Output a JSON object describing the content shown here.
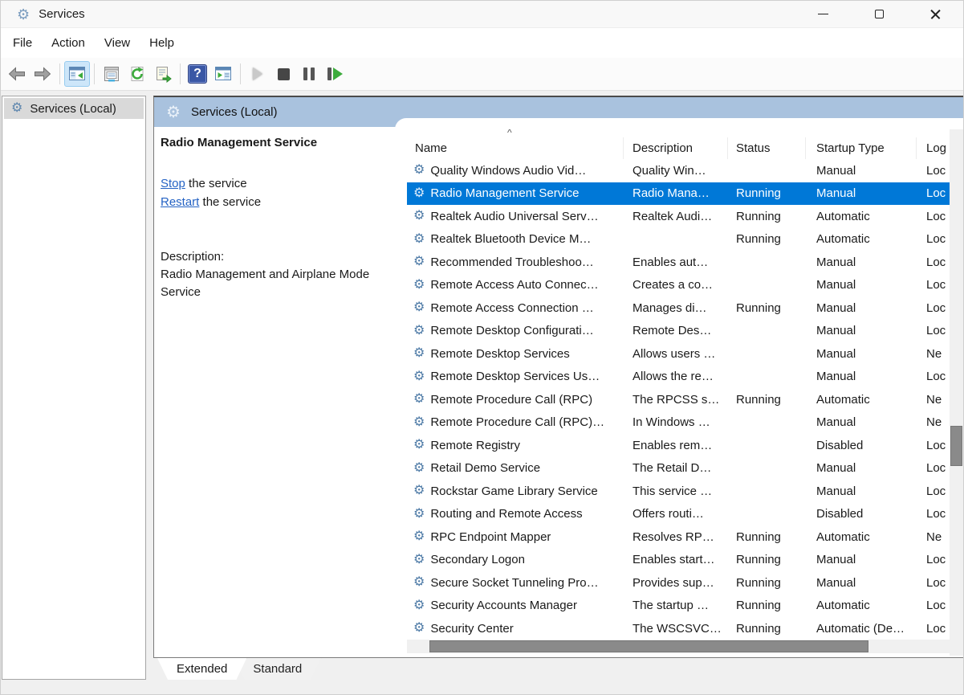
{
  "window": {
    "title": "Services"
  },
  "menu": {
    "items": [
      "File",
      "Action",
      "View",
      "Help"
    ]
  },
  "toolbar": {
    "icons": [
      "back-icon",
      "forward-icon",
      "show-console-tree-icon",
      "properties-icon",
      "refresh-icon",
      "export-list-icon",
      "help-icon",
      "show-action-pane-icon",
      "start-service-icon",
      "stop-service-icon",
      "pause-service-icon",
      "restart-service-icon"
    ],
    "help_glyph": "?"
  },
  "icons": {
    "gear_glyph": "⚙"
  },
  "tree": {
    "root_item": "Services (Local)"
  },
  "banner": {
    "title": "Services (Local)"
  },
  "detail": {
    "service_name": "Radio Management Service",
    "stop_link": "Stop",
    "stop_rest": " the service",
    "restart_link": "Restart",
    "restart_rest": " the service",
    "description_label": "Description:",
    "description_text": "Radio Management and Airplane Mode Service"
  },
  "table": {
    "columns": [
      "Name",
      "Description",
      "Status",
      "Startup Type",
      "Log"
    ],
    "sort_indicator": "^",
    "rows": [
      {
        "name": "Quality Windows Audio Vid…",
        "description": "Quality Win…",
        "status": "",
        "startup": "Manual",
        "logon": "Loc",
        "selected": false
      },
      {
        "name": "Radio Management Service",
        "description": "Radio Mana…",
        "status": "Running",
        "startup": "Manual",
        "logon": "Loc",
        "selected": true
      },
      {
        "name": "Realtek Audio Universal Serv…",
        "description": "Realtek Audi…",
        "status": "Running",
        "startup": "Automatic",
        "logon": "Loc",
        "selected": false
      },
      {
        "name": "Realtek Bluetooth Device M…",
        "description": "",
        "status": "Running",
        "startup": "Automatic",
        "logon": "Loc",
        "selected": false
      },
      {
        "name": "Recommended Troubleshoo…",
        "description": "Enables aut…",
        "status": "",
        "startup": "Manual",
        "logon": "Loc",
        "selected": false
      },
      {
        "name": "Remote Access Auto Connec…",
        "description": "Creates a co…",
        "status": "",
        "startup": "Manual",
        "logon": "Loc",
        "selected": false
      },
      {
        "name": "Remote Access Connection …",
        "description": "Manages di…",
        "status": "Running",
        "startup": "Manual",
        "logon": "Loc",
        "selected": false
      },
      {
        "name": "Remote Desktop Configurati…",
        "description": "Remote Des…",
        "status": "",
        "startup": "Manual",
        "logon": "Loc",
        "selected": false
      },
      {
        "name": "Remote Desktop Services",
        "description": "Allows users …",
        "status": "",
        "startup": "Manual",
        "logon": "Ne",
        "selected": false
      },
      {
        "name": "Remote Desktop Services Us…",
        "description": "Allows the re…",
        "status": "",
        "startup": "Manual",
        "logon": "Loc",
        "selected": false
      },
      {
        "name": "Remote Procedure Call (RPC)",
        "description": "The RPCSS s…",
        "status": "Running",
        "startup": "Automatic",
        "logon": "Ne",
        "selected": false
      },
      {
        "name": "Remote Procedure Call (RPC)…",
        "description": "In Windows …",
        "status": "",
        "startup": "Manual",
        "logon": "Ne",
        "selected": false
      },
      {
        "name": "Remote Registry",
        "description": "Enables rem…",
        "status": "",
        "startup": "Disabled",
        "logon": "Loc",
        "selected": false
      },
      {
        "name": "Retail Demo Service",
        "description": "The Retail D…",
        "status": "",
        "startup": "Manual",
        "logon": "Loc",
        "selected": false
      },
      {
        "name": "Rockstar Game Library Service",
        "description": "This service …",
        "status": "",
        "startup": "Manual",
        "logon": "Loc",
        "selected": false
      },
      {
        "name": "Routing and Remote Access",
        "description": "Offers routi…",
        "status": "",
        "startup": "Disabled",
        "logon": "Loc",
        "selected": false
      },
      {
        "name": "RPC Endpoint Mapper",
        "description": "Resolves RP…",
        "status": "Running",
        "startup": "Automatic",
        "logon": "Ne",
        "selected": false
      },
      {
        "name": "Secondary Logon",
        "description": "Enables start…",
        "status": "Running",
        "startup": "Manual",
        "logon": "Loc",
        "selected": false
      },
      {
        "name": "Secure Socket Tunneling Pro…",
        "description": "Provides sup…",
        "status": "Running",
        "startup": "Manual",
        "logon": "Loc",
        "selected": false
      },
      {
        "name": "Security Accounts Manager",
        "description": "The startup …",
        "status": "Running",
        "startup": "Automatic",
        "logon": "Loc",
        "selected": false
      },
      {
        "name": "Security Center",
        "description": "The WSCSVC…",
        "status": "Running",
        "startup": "Automatic (De…",
        "logon": "Loc",
        "selected": false
      }
    ]
  },
  "tabs": {
    "items": [
      "Extended",
      "Standard"
    ],
    "active": "Extended"
  },
  "colors": {
    "selection_blue": "#0078d7",
    "banner_blue": "#a9c2de",
    "link_blue": "#2563c4",
    "tree_selected_gray": "#d9d9d9",
    "scrollbar_thumb": "#8a8a8a"
  }
}
